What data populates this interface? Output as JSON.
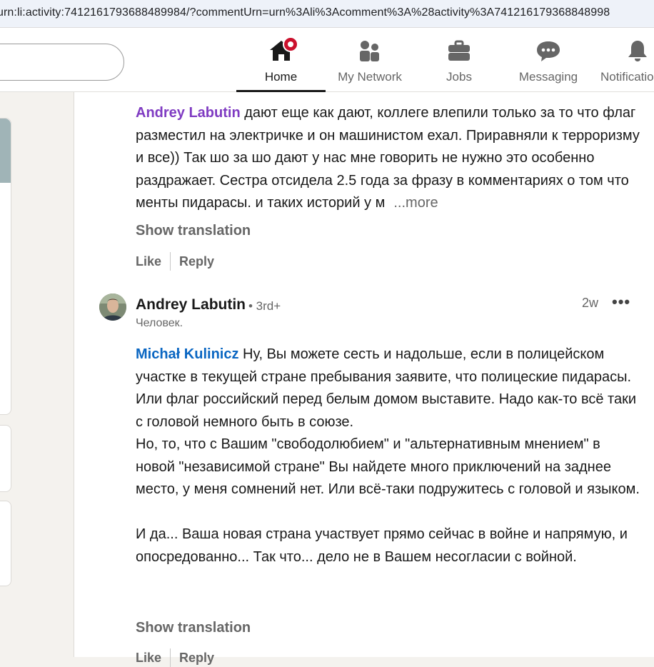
{
  "browser": {
    "url": "urn:li:activity:7412161793688489984/?commentUrn=urn%3Ali%3Acomment%3A%28activity%3A741216179368848998"
  },
  "nav": {
    "items": [
      {
        "label": "Home",
        "icon": "home-icon",
        "active": true
      },
      {
        "label": "My Network",
        "icon": "network-icon"
      },
      {
        "label": "Jobs",
        "icon": "briefcase-icon"
      },
      {
        "label": "Messaging",
        "icon": "messaging-icon"
      },
      {
        "label": "Notifications",
        "icon": "bell-icon"
      }
    ]
  },
  "comments": {
    "first": {
      "mention": "Andrey Labutin",
      "text": " дают еще как дают, коллеге влепили только за то что флаг разместил на электричке и он машинистом ехал. Приравняли к терроризму и все)) Так шо за шо дают у нас мне говорить не нужно это особенно раздражает. Сестра отсидела 2.5 года за фразу в комментариях о том что менты пидарасы. и таких историй у м",
      "more": "...more",
      "show_translation": "Show translation",
      "like": "Like",
      "reply": "Reply"
    },
    "second": {
      "author": "Andrey Labutin",
      "degree": "• 3rd+",
      "headline": "Человек.",
      "timestamp": "2w",
      "menu": "•••",
      "mention": "Michał Kulinicz",
      "text_p1": " Ну, Вы можете сесть и надольше, если в полицейском участке в текущей стране пребывания заявите, что полицеские пидарасы. Или флаг российский перед белым домом выставите. Надо как-то всё таки с головой немного быть в союзе.",
      "text_p2": "Но, то, что с Вашим \"свободолюбием\" и \"альтернативным мнением\" в новой \"независимой стране\" Вы найдете много приключений на заднее место, у меня сомнений нет. Или всё-таки подружитесь с головой и языком.",
      "text_p3": "И да... Ваша новая страна участвует прямо сейчас в войне и напрямую, и опосредованно... Так что... дело не в Вашем несогласии с войной.",
      "show_translation": "Show translation",
      "like": "Like",
      "reply": "Reply"
    }
  },
  "colors": {
    "mention_blue": "#0a66c2",
    "mention_visited": "#7f3bc2",
    "notification_red": "#cb112d"
  }
}
